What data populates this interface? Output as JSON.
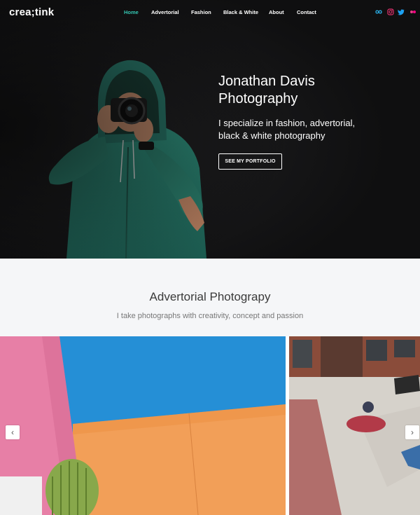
{
  "brand": {
    "logo": "crea;tink"
  },
  "nav": {
    "items": [
      {
        "label": "Home",
        "active": true
      },
      {
        "label": "Advertorial",
        "active": false
      },
      {
        "label": "Fashion",
        "active": false
      },
      {
        "label": "Black & White",
        "active": false
      },
      {
        "label": "About",
        "active": false
      },
      {
        "label": "Contact",
        "active": false
      }
    ],
    "social": [
      {
        "icon": "flickr-infinity-icon",
        "color": "#29a9e0"
      },
      {
        "icon": "instagram-icon",
        "color": "#e1306c"
      },
      {
        "icon": "twitter-icon",
        "color": "#1da1f2"
      },
      {
        "icon": "flickr-dots-icon",
        "color": "#ff0084"
      }
    ],
    "active_color": "#35c6b2"
  },
  "hero": {
    "title_line1": "Jonathan Davis",
    "title_line2": "Photography",
    "subtitle": "I specialize in fashion, advertorial, black & white photography",
    "button": "SEE MY PORTFOLIO"
  },
  "section": {
    "title": "Advertorial Photograpy",
    "subtitle": "I take photographs with creativity, concept and passion"
  },
  "gallery": {
    "prev_icon": "chevron-left-icon",
    "next_icon": "chevron-right-icon",
    "prev_symbol": "‹",
    "next_symbol": "›"
  }
}
